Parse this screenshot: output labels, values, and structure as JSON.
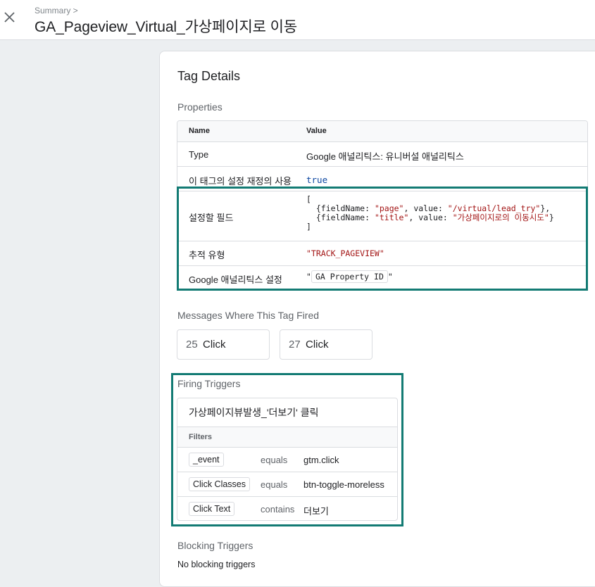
{
  "header": {
    "breadcrumb": "Summary >",
    "title": "GA_Pageview_Virtual_가상페이지로 이동",
    "close_icon": "close-icon"
  },
  "card": {
    "title": "Tag Details",
    "properties_label": "Properties",
    "table_header": {
      "name": "Name",
      "value": "Value"
    },
    "rows": {
      "type": {
        "name": "Type",
        "value": "Google 애널리틱스: 유니버설 애널리틱스"
      },
      "override": {
        "name": "이 태그의 설정 재정의 사용",
        "value": "true"
      },
      "fields": {
        "name": "설정할 필드",
        "open": "[",
        "line1_a": "  {fieldName: ",
        "line1_b": "\"page\"",
        "line1_c": ", value: ",
        "line1_d": "\"/virtual/lead_try\"",
        "line1_e": "},",
        "line2_a": "  {fieldName: ",
        "line2_b": "\"title\"",
        "line2_c": ", value: ",
        "line2_d": "\"가상페이지로의 이동시도\"",
        "line2_e": "}",
        "close": "]"
      },
      "track_type": {
        "name": "추적 유형",
        "value": "\"TRACK_PAGEVIEW\""
      },
      "ga_settings": {
        "name": "Google 애널리틱스 설정",
        "quote_open": "\"",
        "chip": "GA Property ID",
        "quote_close": "\""
      }
    },
    "messages_label": "Messages Where This Tag Fired",
    "messages": [
      {
        "num": "25",
        "label": "Click"
      },
      {
        "num": "27",
        "label": "Click"
      }
    ],
    "firing_label": "Firing Triggers",
    "trigger": {
      "name": "가상페이지뷰발생_'더보기' 클릭",
      "filters_label": "Filters",
      "filters": [
        {
          "variable": "_event",
          "operator": "equals",
          "value": "gtm.click"
        },
        {
          "variable": "Click Classes",
          "operator": "equals",
          "value": "btn-toggle-moreless"
        },
        {
          "variable": "Click Text",
          "operator": "contains",
          "value": "더보기"
        }
      ]
    },
    "blocking_label": "Blocking Triggers",
    "blocking_text": "No blocking triggers"
  },
  "colors": {
    "highlight": "#137b74",
    "string": "#a31515",
    "keyword": "#0d47a1"
  }
}
